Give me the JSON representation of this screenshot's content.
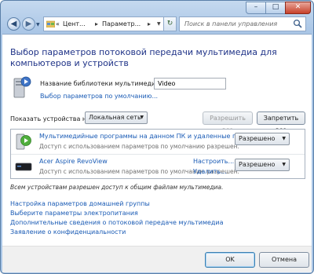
{
  "titlebar": {
    "minimize_glyph": "–",
    "maximize_glyph": "□",
    "close_glyph": "✕"
  },
  "nav": {
    "back_glyph": "◀",
    "forward_glyph": "▶",
    "history_glyph": "▼"
  },
  "address": {
    "crumbs": [
      "Цент...",
      "Параметр..."
    ],
    "separator": "▸",
    "prefix": "«",
    "dropdown_glyph": "▼"
  },
  "refresh_glyph": "↻",
  "search": {
    "placeholder": "Поиск в панели управления"
  },
  "page": {
    "title": "Выбор параметров потоковой передачи мультимедиа для компьютеров и устройств"
  },
  "library": {
    "label": "Название библиотеки мультимедиа:",
    "value": "Video",
    "defaults_link": "Выбор параметров по умолчанию..."
  },
  "devices_filter": {
    "label": "Показать устройства на:",
    "selected": "Локальная сеть",
    "allow_all": "Разрешить все",
    "block_all": "Запретить все"
  },
  "devices": [
    {
      "icon": "media-programs-icon",
      "name": "Мультимедийные программы на данном ПК и удаленные подк...",
      "subtitle": "Доступ с использованием параметров по умолчанию разрешен.",
      "status": "Разрешено"
    },
    {
      "icon": "media-player-device-icon",
      "name": "Acer Aspire RevoView",
      "subtitle": "Доступ с использованием параметров по умолчанию разрешен.",
      "link_customize": "Настроить...",
      "link_remove": "Удалить...",
      "status": "Разрешено"
    }
  ],
  "note": "Всем устройствам разрешен доступ к общим файлам мультимедиа.",
  "links": [
    "Настройка параметров домашней группы",
    "Выберите параметры электропитания",
    "Дополнительные сведения о потоковой передаче мультимедиа",
    "Заявление о конфиденциальности"
  ],
  "footer": {
    "ok": "OK",
    "cancel": "Отмена"
  },
  "colors": {
    "title": "#1e3287",
    "link": "#1a5bb5",
    "frame": "#aac6e6"
  }
}
